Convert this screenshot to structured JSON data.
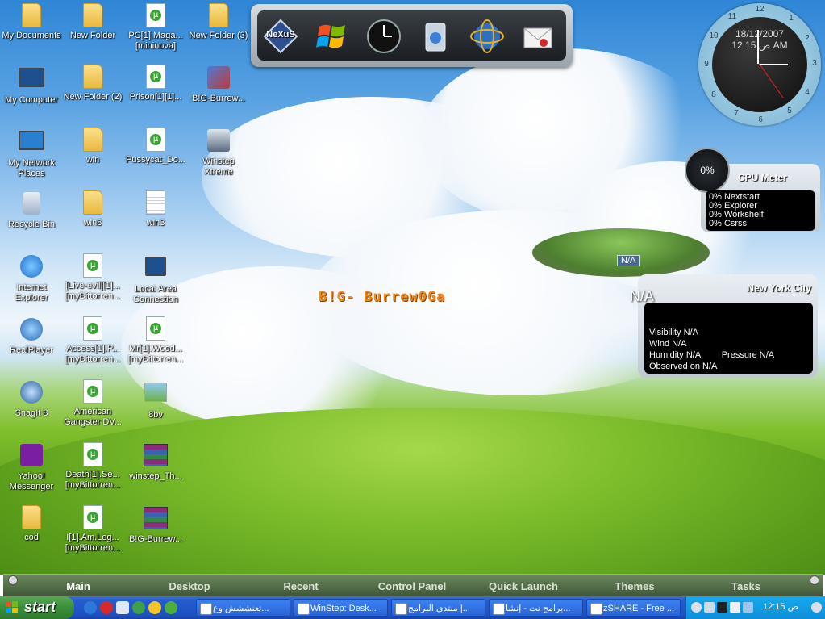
{
  "desktop": {
    "icons": [
      {
        "label1": "My Documents",
        "label2": ""
      },
      {
        "label1": "My Computer",
        "label2": ""
      },
      {
        "label1": "My Network",
        "label2": "Places"
      },
      {
        "label1": "Recycle Bin",
        "label2": ""
      },
      {
        "label1": "Internet",
        "label2": "Explorer"
      },
      {
        "label1": "RealPlayer",
        "label2": ""
      },
      {
        "label1": "SnagIt 8",
        "label2": ""
      },
      {
        "label1": "Yahoo!",
        "label2": "Messenger"
      },
      {
        "label1": "cod",
        "label2": ""
      },
      {
        "label1": "New Folder",
        "label2": ""
      },
      {
        "label1": "New Folder (2)",
        "label2": ""
      },
      {
        "label1": "win",
        "label2": ""
      },
      {
        "label1": "win8",
        "label2": ""
      },
      {
        "label1": "[Live-evil][1]...",
        "label2": "[myBittorren..."
      },
      {
        "label1": "Access[1].P...",
        "label2": "[myBittorren..."
      },
      {
        "label1": "American",
        "label2": "Gangster DV..."
      },
      {
        "label1": "Death[1].Se...",
        "label2": "[myBittorren..."
      },
      {
        "label1": "I[1].Am.Leg...",
        "label2": "[myBittorren..."
      },
      {
        "label1": "PC[1].Maga...",
        "label2": "[mininova]"
      },
      {
        "label1": "Prison[1][1]...",
        "label2": ""
      },
      {
        "label1": "Pussycat_Do...",
        "label2": ""
      },
      {
        "label1": "win3",
        "label2": ""
      },
      {
        "label1": "Local Area",
        "label2": "Connection"
      },
      {
        "label1": "Mr[1].Wood...",
        "label2": "[myBittorren..."
      },
      {
        "label1": "8bv",
        "label2": ""
      },
      {
        "label1": "winstep_Th...",
        "label2": ""
      },
      {
        "label1": "B!G-Burrew...",
        "label2": ""
      },
      {
        "label1": "New Folder (3)",
        "label2": ""
      },
      {
        "label1": "B!G-Burrew...",
        "label2": ""
      },
      {
        "label1": "Winstep",
        "label2": "Xtreme"
      }
    ],
    "watermark": "B!G- Burrew0Ga"
  },
  "dock": {
    "items": [
      "NeXuS"
    ]
  },
  "clock": {
    "date": "18/12/2007",
    "time": "12:15 ص AM",
    "numerals": [
      "12",
      "1",
      "2",
      "3",
      "4",
      "5",
      "6",
      "7",
      "8",
      "9",
      "10",
      "11"
    ]
  },
  "cpu_meter": {
    "dial": "0%",
    "title": "CPU Meter",
    "rows": [
      "0% Nextstart",
      "0% Explorer",
      "0% Workshelf",
      "0% Csrss"
    ]
  },
  "weather": {
    "city": "New York City",
    "temp": "N/A",
    "island_tag": "N/A",
    "visibility": "Visibility N/A",
    "wind": "Wind N/A",
    "humidity": "Humidity N/A",
    "pressure": "Pressure N/A",
    "observed": "Observed on N/A"
  },
  "nextstart": {
    "tabs": [
      "Main",
      "Desktop",
      "Recent",
      "Control Panel",
      "Quick Launch",
      "Themes",
      "Tasks"
    ]
  },
  "taskbar": {
    "start_label": "start",
    "buttons": [
      "تعنششش وع...",
      "WinStep: Desk...",
      "منتدى البرامج |...",
      "برامج نت - إنشا...",
      "zSHARE - Free ..."
    ],
    "clock": "ص 12:15"
  },
  "colors": {
    "taskbar": "#245bd0",
    "start": "#3a8e3a",
    "tray": "#0f8ed8",
    "watermark": "#f08a12"
  }
}
